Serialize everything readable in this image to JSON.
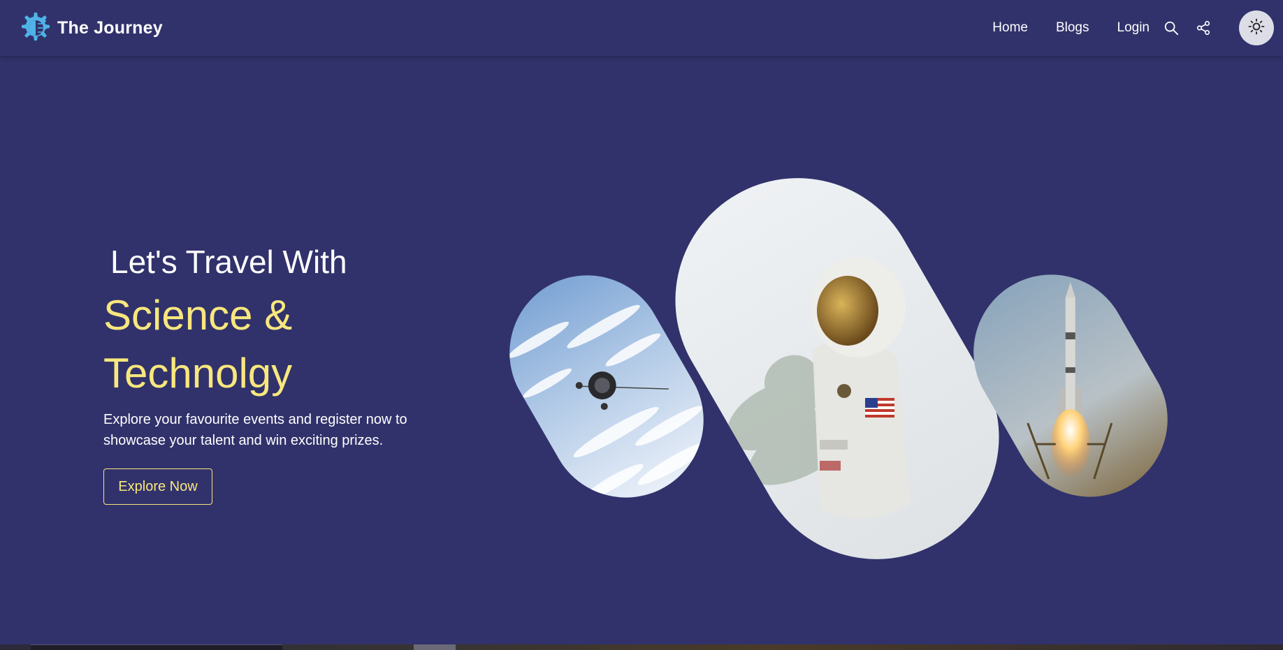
{
  "header": {
    "brand_title": "The Journey",
    "nav": [
      {
        "label": "Home"
      },
      {
        "label": "Blogs"
      },
      {
        "label": "Login"
      }
    ],
    "icons": {
      "logo": "gear-circuit-logo-icon",
      "search": "search-icon",
      "share": "share-icon",
      "theme": "sun-icon"
    }
  },
  "hero": {
    "line1": "Let's Travel With",
    "line2": "Science &",
    "line3": "Technolgy",
    "description": "Explore your favourite events and register now to showcase your talent and win exciting prizes.",
    "cta_label": "Explore Now"
  },
  "images": [
    {
      "subject": "satellite-over-earth"
    },
    {
      "subject": "astronaut-in-spacesuit"
    },
    {
      "subject": "rocket-launch"
    }
  ],
  "colors": {
    "background": "#31326b",
    "accent": "#f8e77d",
    "text": "#ffffff",
    "logo": "#4fb3e8"
  }
}
